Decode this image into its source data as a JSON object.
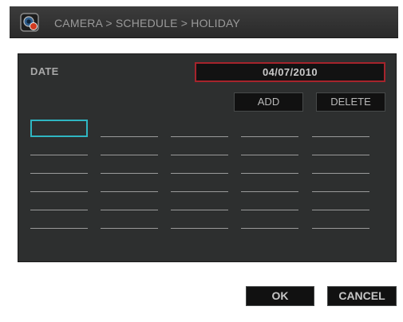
{
  "window": {
    "title": "CAMERA > SCHEDULE > HOLIDAY",
    "icon": "camera-icon"
  },
  "form": {
    "date_label": "DATE",
    "date_value": "04/07/2010",
    "add_label": "ADD",
    "delete_label": "DELETE"
  },
  "holiday_list": {
    "columns": 5,
    "rows": 6,
    "selected_index": 0,
    "entries": [
      "",
      "",
      "",
      "",
      "",
      "",
      "",
      "",
      "",
      "",
      "",
      "",
      "",
      "",
      "",
      "",
      "",
      "",
      "",
      "",
      "",
      "",
      "",
      "",
      "",
      "",
      "",
      "",
      "",
      ""
    ]
  },
  "footer": {
    "ok_label": "OK",
    "cancel_label": "CANCEL"
  },
  "colors": {
    "panel_bg": "#2d2f2f",
    "date_border": "#a6242c",
    "selection_border": "#2fb6c2",
    "button_bg": "#111111"
  }
}
